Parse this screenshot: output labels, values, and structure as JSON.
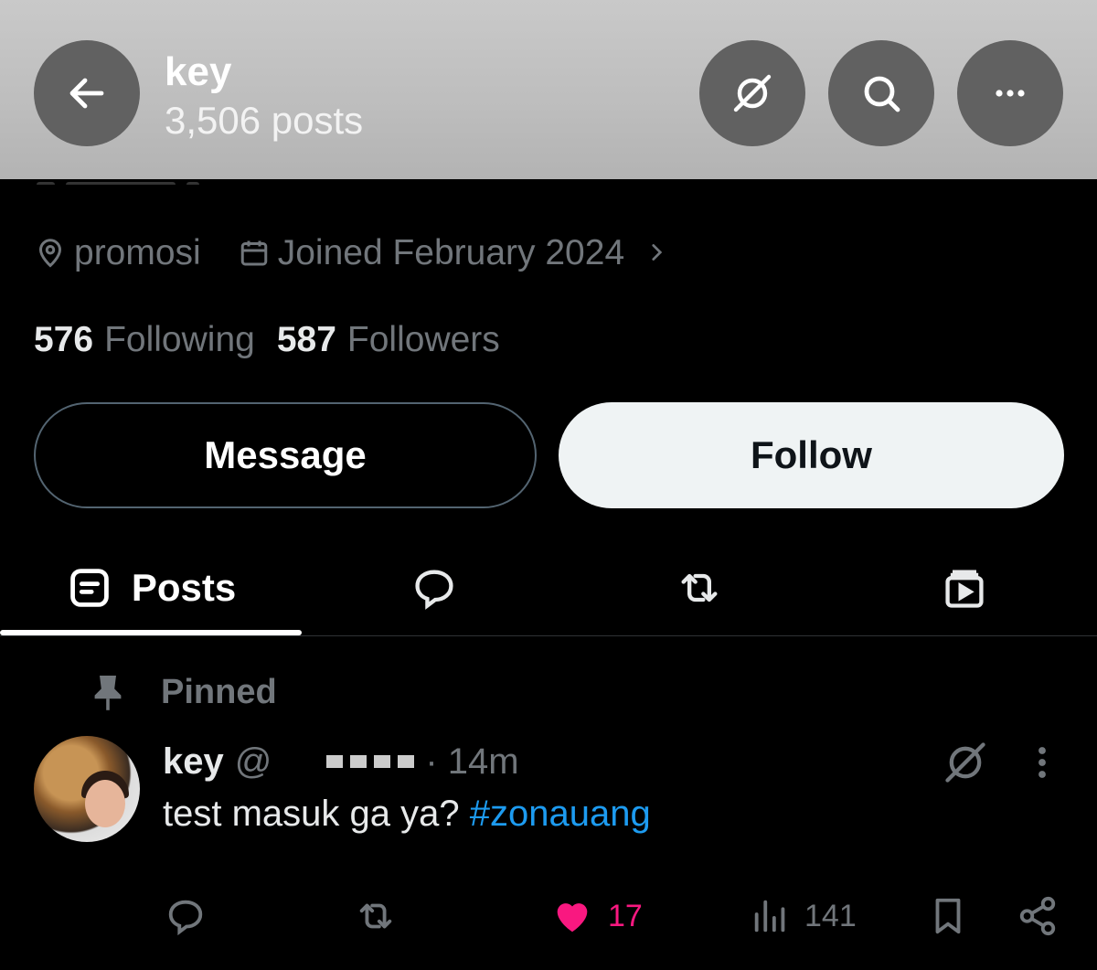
{
  "header": {
    "name": "key",
    "posts": "3,506 posts"
  },
  "profile": {
    "location": "promosi",
    "joined": "Joined February 2024",
    "following_count": "576",
    "following_label": "Following",
    "followers_count": "587",
    "followers_label": "Followers"
  },
  "buttons": {
    "message": "Message",
    "follow": "Follow"
  },
  "tabs": {
    "posts_label": "Posts"
  },
  "post": {
    "pinned_label": "Pinned",
    "name": "key",
    "handle": "@",
    "time": "· 14m",
    "text": "test masuk ga ya? ",
    "hashtag": "#zonauang",
    "likes": "17",
    "views": "141"
  },
  "colors": {
    "accent": "#1d9bf0",
    "like": "#f91880",
    "muted": "#71767b"
  },
  "icons": {
    "back": "arrow-left-icon",
    "grok": "grok-icon",
    "search": "search-icon",
    "more": "more-horizontal-icon",
    "location": "location-pin-icon",
    "calendar": "calendar-icon",
    "pin": "pin-icon"
  }
}
